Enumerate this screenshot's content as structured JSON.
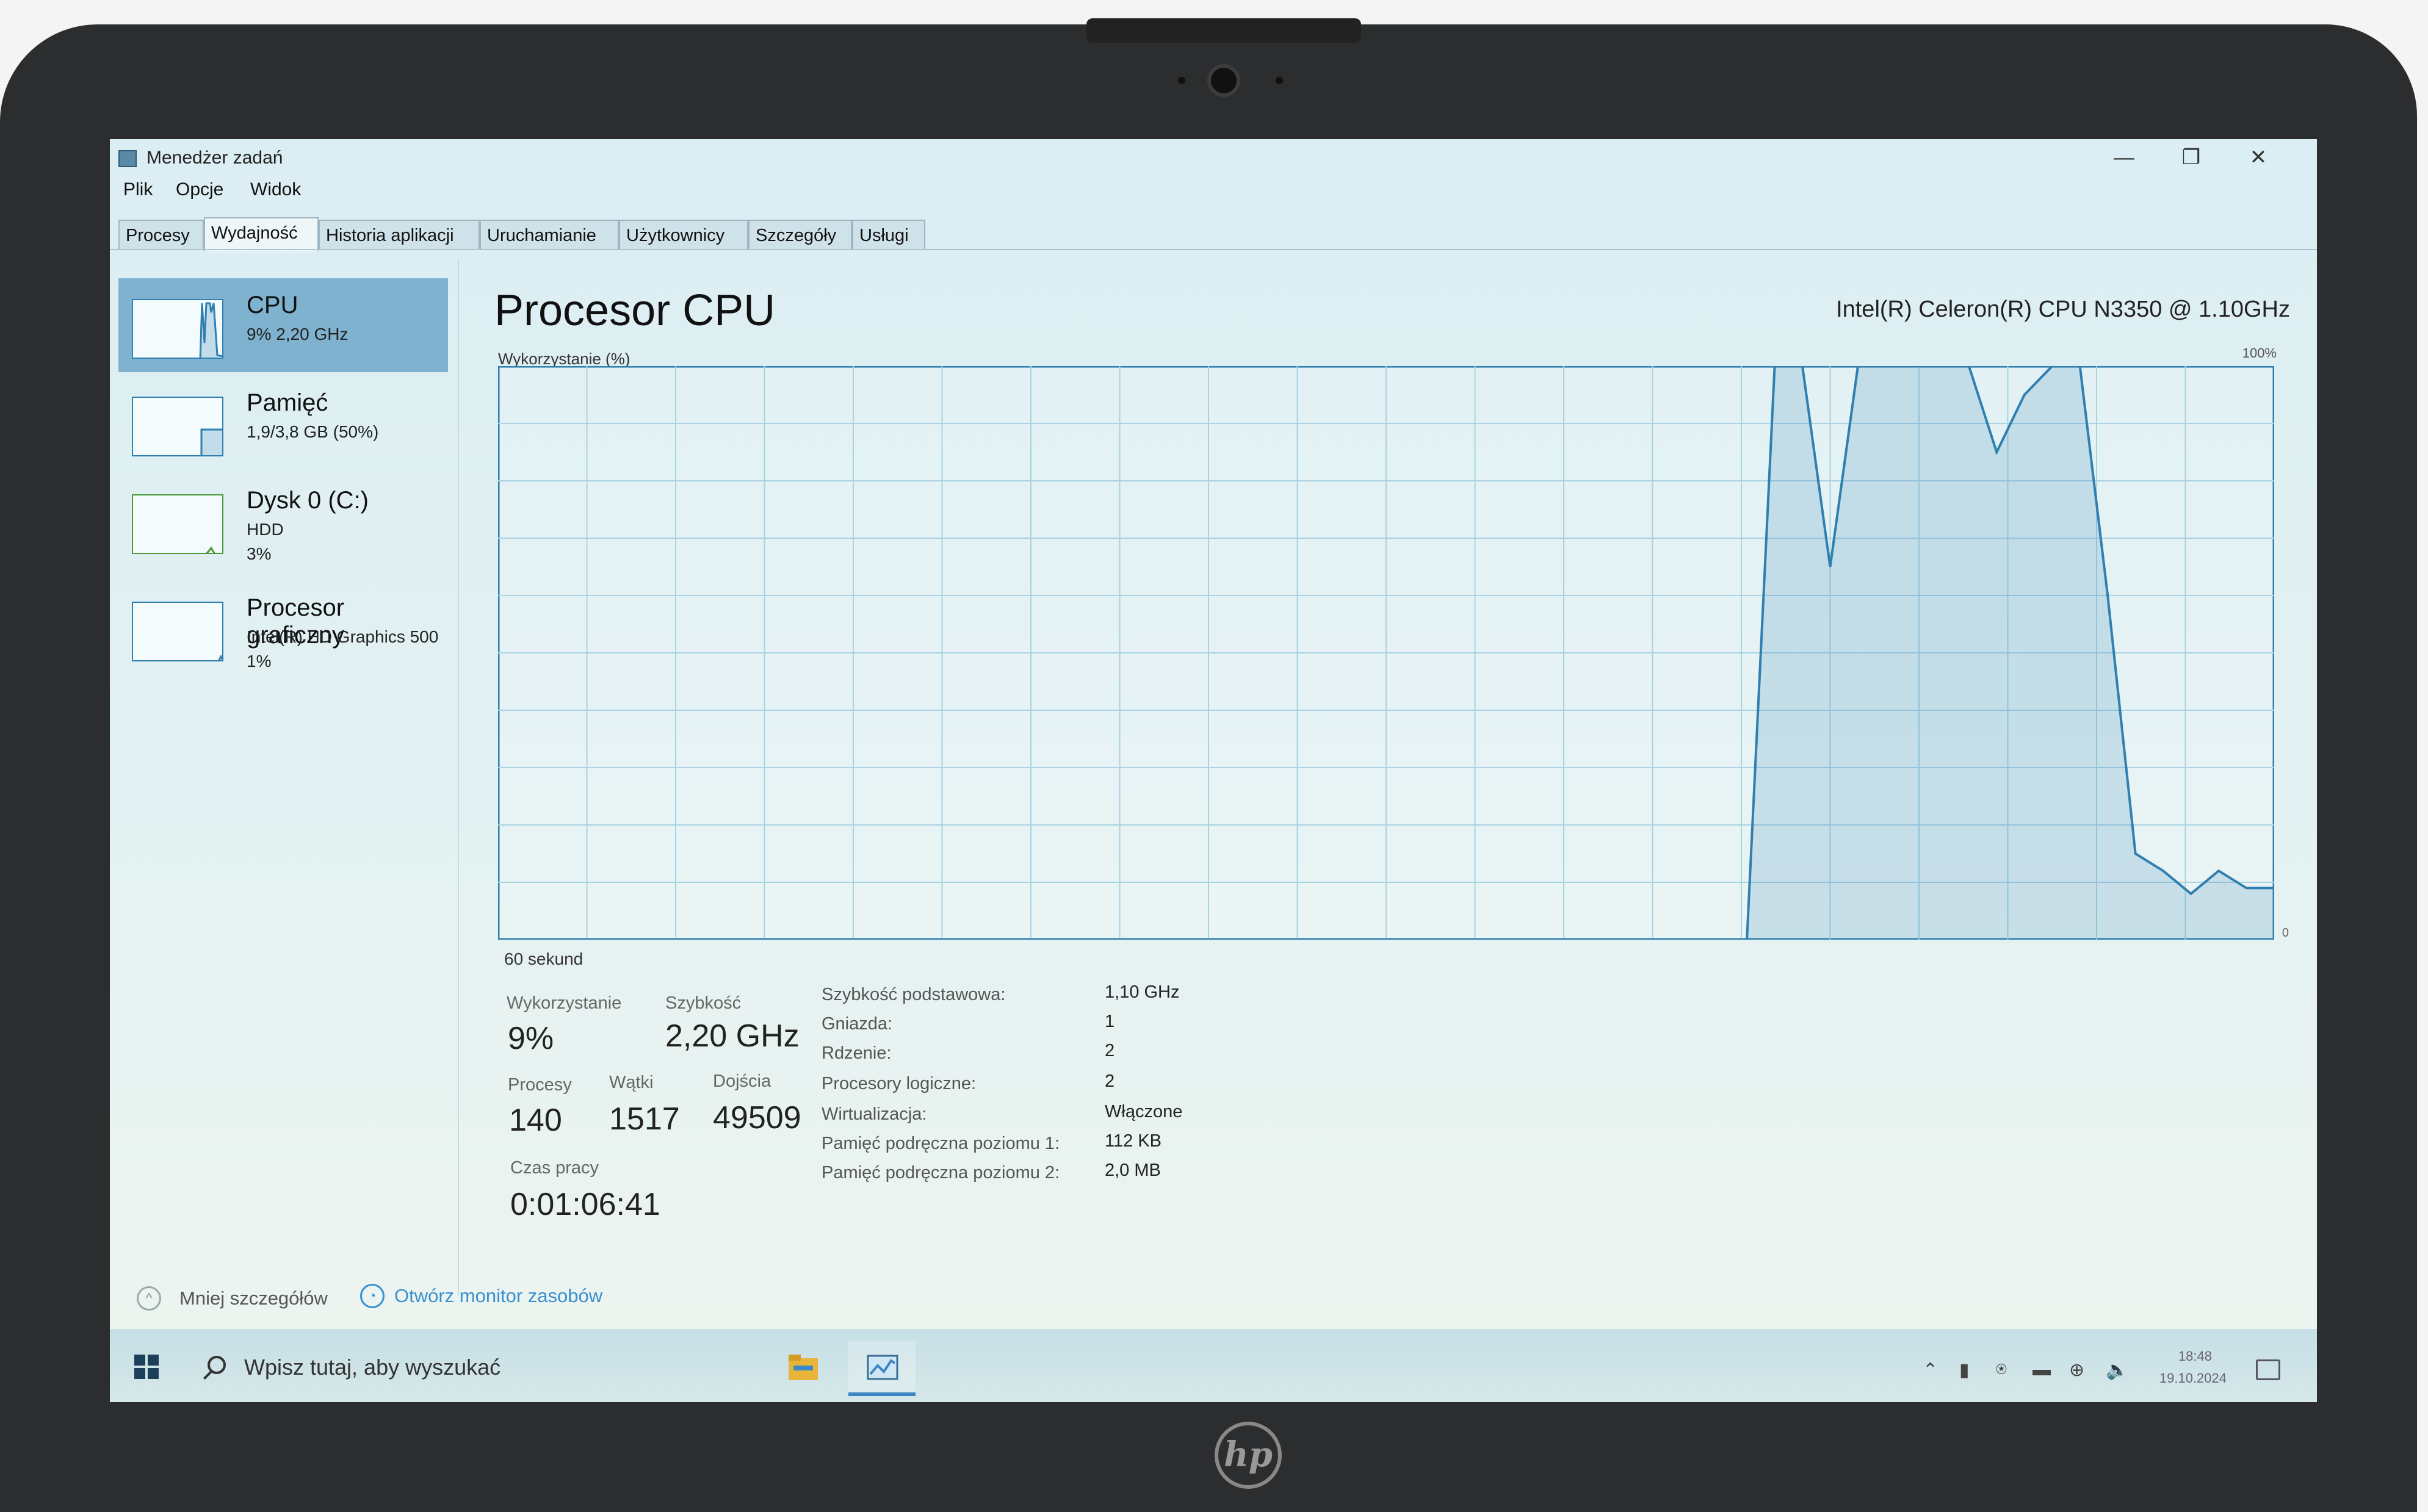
{
  "window": {
    "title": "Menedżer zadań",
    "controls": {
      "minimize": "—",
      "restore": "❐",
      "close": "✕"
    }
  },
  "menu": [
    "Plik",
    "Opcje",
    "Widok"
  ],
  "tabs": [
    "Procesy",
    "Wydajność",
    "Historia aplikacji",
    "Uruchamianie",
    "Użytkownicy",
    "Szczegóły",
    "Usługi"
  ],
  "active_tab": "Wydajność",
  "sidebar": {
    "items": [
      {
        "title": "CPU",
        "lines": [
          "9% 2,20 GHz"
        ]
      },
      {
        "title": "Pamięć",
        "lines": [
          "1,9/3,8 GB (50%)"
        ]
      },
      {
        "title": "Dysk 0 (C:)",
        "lines": [
          "HDD",
          "3%"
        ]
      },
      {
        "title": "Procesor graficzny",
        "lines": [
          "Intel(R) HD Graphics 500",
          "1%"
        ]
      }
    ]
  },
  "main": {
    "title": "Procesor CPU",
    "cpu_model": "Intel(R) Celeron(R) CPU N3350 @ 1.10GHz",
    "graph_label": "Wykorzystanie (%)",
    "graph_max": "100%",
    "graph_min": "0",
    "time_span": "60 sekund",
    "stats": {
      "usage_label": "Wykorzystanie",
      "usage_value": "9%",
      "speed_label": "Szybkość",
      "speed_value": "2,20 GHz",
      "processes_label": "Procesy",
      "processes_value": "140",
      "threads_label": "Wątki",
      "threads_value": "1517",
      "handles_label": "Dojścia",
      "handles_value": "49509",
      "uptime_label": "Czas pracy",
      "uptime_value": "0:01:06:41"
    },
    "specs": [
      {
        "label": "Szybkość podstawowa:",
        "value": "1,10 GHz"
      },
      {
        "label": "Gniazda:",
        "value": "1"
      },
      {
        "label": "Rdzenie:",
        "value": "2"
      },
      {
        "label": "Procesory logiczne:",
        "value": "2"
      },
      {
        "label": "Wirtualizacja:",
        "value": "Włączone"
      },
      {
        "label": "Pamięć podręczna poziomu 1:",
        "value": "112 KB"
      },
      {
        "label": "Pamięć podręczna poziomu 2:",
        "value": "2,0 MB"
      }
    ]
  },
  "footer": {
    "less_details": "Mniej szczegółów",
    "resource_monitor": "Otwórz monitor zasobów"
  },
  "taskbar": {
    "search_placeholder": "Wpisz tutaj, aby wyszukać",
    "time": "18:48",
    "date": "19.10.2024"
  },
  "colors": {
    "accent": "#2f7fb0",
    "link": "#3a8fd0",
    "selected": "#7fb2cf"
  },
  "cpu_history": [
    0,
    0,
    0,
    0,
    0,
    0,
    0,
    0,
    0,
    0,
    0,
    0,
    0,
    0,
    0,
    0,
    0,
    0,
    0,
    0,
    0,
    0,
    0,
    0,
    0,
    0,
    0,
    0,
    0,
    0,
    0,
    0,
    0,
    0,
    0,
    0,
    0,
    0,
    0,
    0,
    0,
    0,
    0,
    0,
    0,
    0,
    100,
    100,
    65,
    100,
    100,
    100,
    100,
    100,
    85,
    95,
    100,
    100,
    60,
    15,
    12,
    8,
    12,
    9,
    9
  ]
}
